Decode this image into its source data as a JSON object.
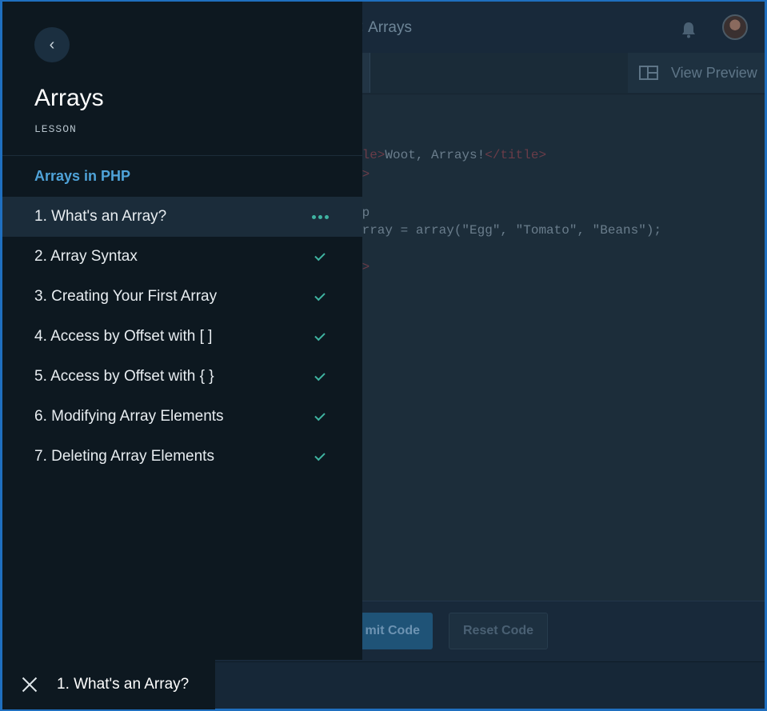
{
  "app": {
    "breadcrumb_sep": "<",
    "title": "Arrays",
    "view_preview_label": "View Preview",
    "submit_label": "mit Code",
    "reset_label": "Reset Code",
    "code_lines": [
      {
        "pre": "",
        "tag": ">",
        "text": ""
      },
      {
        "pre": "",
        "tag": "tle>",
        "text": "Woot, Arrays!",
        "tag2": "</title>"
      },
      {
        "pre": "",
        "tag": "d>",
        "text": ""
      },
      {
        "pre": "",
        "tag": ">",
        "text": ""
      },
      {
        "pre": "",
        "tag": "",
        "text": "hp"
      },
      {
        "pre": "",
        "tag": "",
        "text": "array = array(\"Egg\", \"Tomato\", \"Beans\");"
      },
      {
        "pre": "",
        "tag": "",
        "text": ""
      },
      {
        "pre": "",
        "tag": "y>",
        "text": ""
      }
    ]
  },
  "panel": {
    "back_label": "‹",
    "title": "Arrays",
    "kind": "LESSON",
    "section_title": "Arrays in PHP",
    "items": [
      {
        "label": "1. What's an Array?",
        "status": "in-progress"
      },
      {
        "label": "2. Array Syntax",
        "status": "complete"
      },
      {
        "label": "3. Creating Your First Array",
        "status": "complete"
      },
      {
        "label": "4. Access by Offset with [ ]",
        "status": "complete"
      },
      {
        "label": "5. Access by Offset with { }",
        "status": "complete"
      },
      {
        "label": "6. Modifying Array Elements",
        "status": "complete"
      },
      {
        "label": "7. Deleting Array Elements",
        "status": "complete"
      }
    ]
  },
  "current": {
    "label": "1. What's an Array?"
  },
  "colors": {
    "accent": "#4fa3d9",
    "check": "#3fb3a1",
    "panel_bg": "#0d1820",
    "active_row": "#1b2c3a"
  }
}
